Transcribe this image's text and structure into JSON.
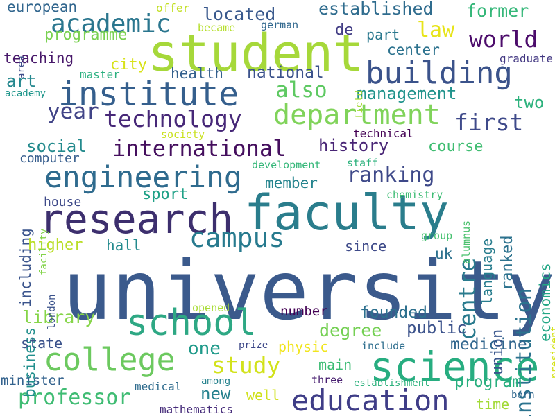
{
  "words": [
    {
      "id": "university",
      "text": "university",
      "color": "#3b5a8c"
    },
    {
      "id": "student",
      "text": "student",
      "color": "#a6d83a"
    },
    {
      "id": "faculty",
      "text": "faculty",
      "color": "#2a7d8c"
    },
    {
      "id": "research",
      "text": "research",
      "color": "#3d2f6e"
    },
    {
      "id": "science",
      "text": "science",
      "color": "#27ad80"
    },
    {
      "id": "institute",
      "text": "institute",
      "color": "#355f8d"
    },
    {
      "id": "school",
      "text": "school",
      "color": "#2ea884"
    },
    {
      "id": "building",
      "text": "building",
      "color": "#3b538b"
    },
    {
      "id": "education",
      "text": "education",
      "color": "#3f3d87"
    },
    {
      "id": "college",
      "text": "college",
      "color": "#6cc95f"
    },
    {
      "id": "department",
      "text": "department",
      "color": "#80d35a"
    },
    {
      "id": "engineering",
      "text": "engineering",
      "color": "#2f6b8e"
    },
    {
      "id": "campus",
      "text": "campus",
      "color": "#277a8e"
    },
    {
      "id": "academic",
      "text": "academic",
      "color": "#2a768e"
    },
    {
      "id": "technology",
      "text": "technology",
      "color": "#472878"
    },
    {
      "id": "international",
      "text": "international",
      "color": "#450f5e"
    },
    {
      "id": "study",
      "text": "study",
      "color": "#d2e21b"
    },
    {
      "id": "professor",
      "text": "professor",
      "color": "#3fbc73"
    },
    {
      "id": "centre",
      "text": "centre",
      "color": "#2a7b8e"
    },
    {
      "id": "institution",
      "text": "institution",
      "color": "#2b738e"
    },
    {
      "id": "also",
      "text": "also",
      "color": "#5ec962"
    },
    {
      "id": "year",
      "text": "year",
      "color": "#414487"
    },
    {
      "id": "first",
      "text": "first",
      "color": "#3f4a8a"
    },
    {
      "id": "world",
      "text": "world",
      "color": "#4c0c6b"
    },
    {
      "id": "law",
      "text": "law",
      "color": "#e7e419"
    },
    {
      "id": "ranking",
      "text": "ranking",
      "color": "#3e4989"
    },
    {
      "id": "located",
      "text": "located",
      "color": "#38588c"
    },
    {
      "id": "established",
      "text": "established",
      "color": "#2f6c8e"
    },
    {
      "id": "former",
      "text": "former",
      "color": "#35b779"
    },
    {
      "id": "history",
      "text": "history",
      "color": "#482475"
    },
    {
      "id": "social",
      "text": "social",
      "color": "#238a8d"
    },
    {
      "id": "national",
      "text": "national",
      "color": "#3b528b"
    },
    {
      "id": "management",
      "text": "management",
      "color": "#20938c"
    },
    {
      "id": "health",
      "text": "health",
      "color": "#34608d"
    },
    {
      "id": "medicine",
      "text": "medicine",
      "color": "#31668e"
    },
    {
      "id": "founded",
      "text": "founded",
      "color": "#2d708e"
    },
    {
      "id": "library",
      "text": "library",
      "color": "#86d549"
    },
    {
      "id": "degree",
      "text": "degree",
      "color": "#75d054"
    },
    {
      "id": "program",
      "text": "program",
      "color": "#29af7f"
    },
    {
      "id": "new",
      "text": "new",
      "color": "#26828e"
    },
    {
      "id": "one",
      "text": "one",
      "color": "#1f9a8a"
    },
    {
      "id": "public",
      "text": "public",
      "color": "#3b528b"
    },
    {
      "id": "economics",
      "text": "economics",
      "color": "#22a785"
    },
    {
      "id": "ranked",
      "text": "ranked",
      "color": "#2c728e"
    },
    {
      "id": "language",
      "text": "language",
      "color": "#287d8e"
    },
    {
      "id": "union",
      "text": "union",
      "color": "#39568c"
    },
    {
      "id": "business",
      "text": "business",
      "color": "#218f8d"
    },
    {
      "id": "including",
      "text": "including",
      "color": "#3a548c"
    },
    {
      "id": "course",
      "text": "course",
      "color": "#40bd72"
    },
    {
      "id": "two",
      "text": "two",
      "color": "#2db27d"
    },
    {
      "id": "sport",
      "text": "sport",
      "color": "#1fa187"
    },
    {
      "id": "member",
      "text": "member",
      "color": "#25848e"
    },
    {
      "id": "higher",
      "text": "higher",
      "color": "#bade28"
    },
    {
      "id": "hall",
      "text": "hall",
      "color": "#238a8d"
    },
    {
      "id": "since",
      "text": "since",
      "color": "#3e4a89"
    },
    {
      "id": "uk",
      "text": "uk",
      "color": "#2c718e"
    },
    {
      "id": "city",
      "text": "city",
      "color": "#d8e219"
    },
    {
      "id": "art",
      "text": "art",
      "color": "#24878e"
    },
    {
      "id": "teaching",
      "text": "teaching",
      "color": "#48186a"
    },
    {
      "id": "programme",
      "text": "programme",
      "color": "#7ad151"
    },
    {
      "id": "european",
      "text": "european",
      "color": "#31668e"
    },
    {
      "id": "de",
      "text": "de",
      "color": "#433e85"
    },
    {
      "id": "part",
      "text": "part",
      "color": "#2a788e"
    },
    {
      "id": "center",
      "text": "center",
      "color": "#2c728e"
    },
    {
      "id": "house",
      "text": "house",
      "color": "#3e4a89"
    },
    {
      "id": "computer",
      "text": "computer",
      "color": "#365d8d"
    },
    {
      "id": "state",
      "text": "state",
      "color": "#3b528b"
    },
    {
      "id": "minister",
      "text": "minister",
      "color": "#33628d"
    },
    {
      "id": "main",
      "text": "main",
      "color": "#3dbc74"
    },
    {
      "id": "physic",
      "text": "physic",
      "color": "#f1e51d"
    },
    {
      "id": "well",
      "text": "well",
      "color": "#d0e11c"
    },
    {
      "id": "time",
      "text": "time",
      "color": "#a2da37"
    },
    {
      "id": "number",
      "text": "number",
      "color": "#440154"
    },
    {
      "id": "graduate",
      "text": "graduate",
      "color": "#443983"
    },
    {
      "id": "master",
      "text": "master",
      "color": "#2ab07f"
    },
    {
      "id": "academy",
      "text": "academy",
      "color": "#1f968b"
    },
    {
      "id": "offer",
      "text": "offer",
      "color": "#c2df23"
    },
    {
      "id": "became",
      "text": "became",
      "color": "#b5de2b"
    },
    {
      "id": "german",
      "text": "german",
      "color": "#31688e"
    },
    {
      "id": "area",
      "text": "area",
      "color": "#3e4c8a"
    },
    {
      "id": "field",
      "text": "field",
      "color": "#a5db36"
    },
    {
      "id": "society",
      "text": "society",
      "color": "#cae11f"
    },
    {
      "id": "technical",
      "text": "technical",
      "color": "#440154"
    },
    {
      "id": "development",
      "text": "development",
      "color": "#35b779"
    },
    {
      "id": "staff",
      "text": "staff",
      "color": "#2db27d"
    },
    {
      "id": "alumnus",
      "text": "alumnus",
      "color": "#4ac16d"
    },
    {
      "id": "chemistry",
      "text": "chemistry",
      "color": "#3dbc74"
    },
    {
      "id": "facility",
      "text": "facility",
      "color": "#84d44b"
    },
    {
      "id": "group",
      "text": "group",
      "color": "#46c06f"
    },
    {
      "id": "london",
      "text": "london",
      "color": "#3b528b"
    },
    {
      "id": "opened",
      "text": "opened",
      "color": "#a8db34"
    },
    {
      "id": "prize",
      "text": "prize",
      "color": "#3e4989"
    },
    {
      "id": "include",
      "text": "include",
      "color": "#2e6e8e"
    },
    {
      "id": "president",
      "text": "president",
      "color": "#d5e21a"
    },
    {
      "id": "medical",
      "text": "medical",
      "color": "#2f6c8e"
    },
    {
      "id": "among",
      "text": "among",
      "color": "#26828e"
    },
    {
      "id": "three",
      "text": "three",
      "color": "#481f70"
    },
    {
      "id": "establishment",
      "text": "establishment",
      "color": "#2db27d"
    },
    {
      "id": "born",
      "text": "born",
      "color": "#31688e"
    },
    {
      "id": "mathematics",
      "text": "mathematics",
      "color": "#472d7b"
    }
  ]
}
